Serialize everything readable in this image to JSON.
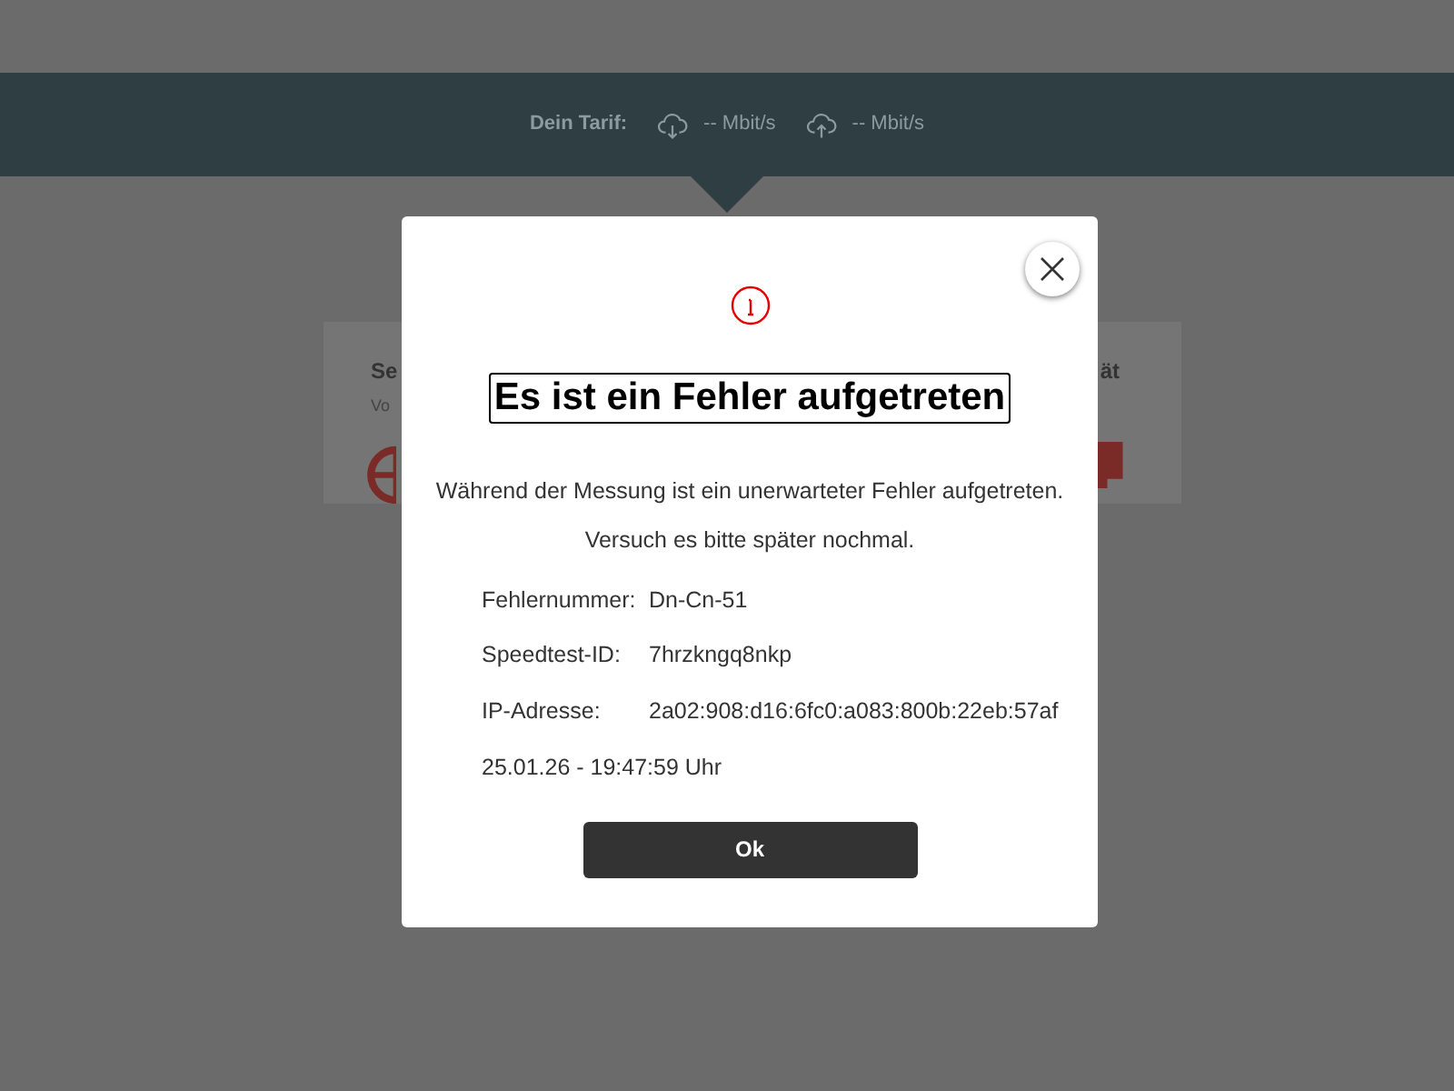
{
  "header": {
    "label": "Dein Tarif:",
    "download": "-- Mbit/s",
    "upload": "-- Mbit/s"
  },
  "cards": [
    {
      "title": "Se",
      "subtitle": "Vo"
    },
    {
      "title": "ät"
    }
  ],
  "dialog": {
    "title": "Es ist ein Fehler aufgetreten",
    "message": "Während der Messung ist ein unerwarteter Fehler aufgetreten.",
    "hint": "Versuch es bitte später nochmal.",
    "details": [
      {
        "label": "Fehlernummer:",
        "value": "Dn-Cn-51"
      },
      {
        "label": "Speedtest-ID:",
        "value": "7hrzkngq8nkp"
      },
      {
        "label": "IP-Adresse:",
        "value": "2a02:908:d16:6fc0:a083:800b:22eb:57af"
      }
    ],
    "timestamp": "25.01.26 - 19:47:59 Uhr",
    "button": "Ok"
  }
}
